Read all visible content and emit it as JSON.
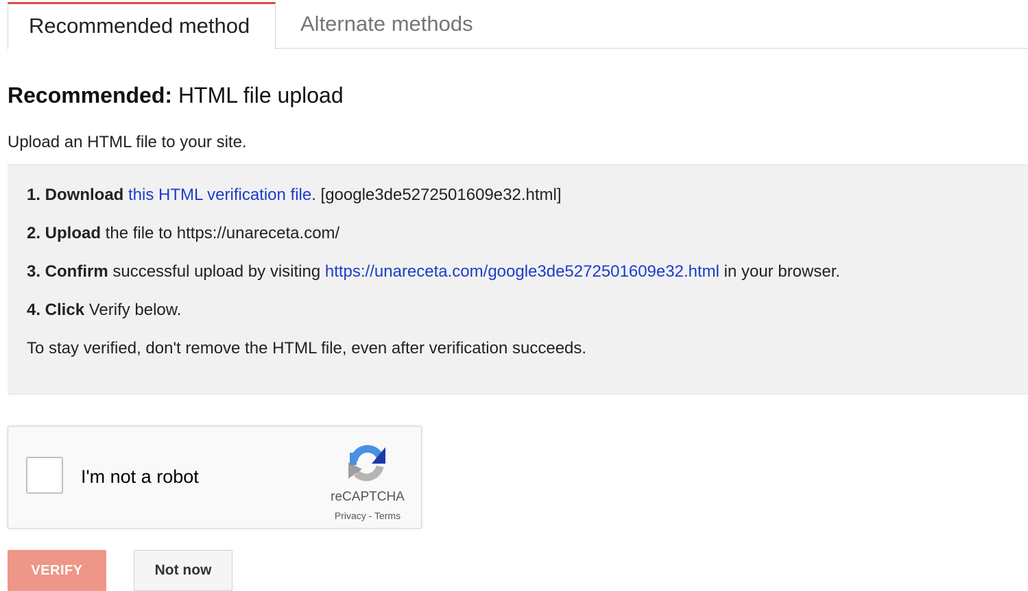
{
  "tabs": {
    "recommended": "Recommended method",
    "alternate": "Alternate methods"
  },
  "heading": {
    "bold": "Recommended:",
    "rest": " HTML file upload"
  },
  "subtext": "Upload an HTML file to your site.",
  "steps": {
    "step1": {
      "bold": "1. Download",
      "link": "this HTML verification file",
      "after": ". [google3de5272501609e32.html]"
    },
    "step2": {
      "bold": "2. Upload",
      "text": " the file to https://unareceta.com/"
    },
    "step3": {
      "bold": "3. Confirm",
      "text": " successful upload by visiting ",
      "link": "https://unareceta.com/google3de5272501609e32.html",
      "after": " in your browser."
    },
    "step4": {
      "bold": "4. Click",
      "text": " Verify below."
    },
    "note": "To stay verified, don't remove the HTML file, even after verification succeeds."
  },
  "captcha": {
    "label": "I'm not a robot",
    "brand": "reCAPTCHA",
    "privacy": "Privacy",
    "separator": " - ",
    "terms": "Terms",
    "checked": false
  },
  "buttons": {
    "verify": "VERIFY",
    "not_now": "Not now"
  },
  "colors": {
    "active_tab_accent": "#dd4b39",
    "link": "#1a3ec9",
    "verify_button": "#ee9688",
    "panel_background": "#f1f1f1"
  },
  "icons": {
    "captcha_logo": "recaptcha-logo-icon"
  }
}
